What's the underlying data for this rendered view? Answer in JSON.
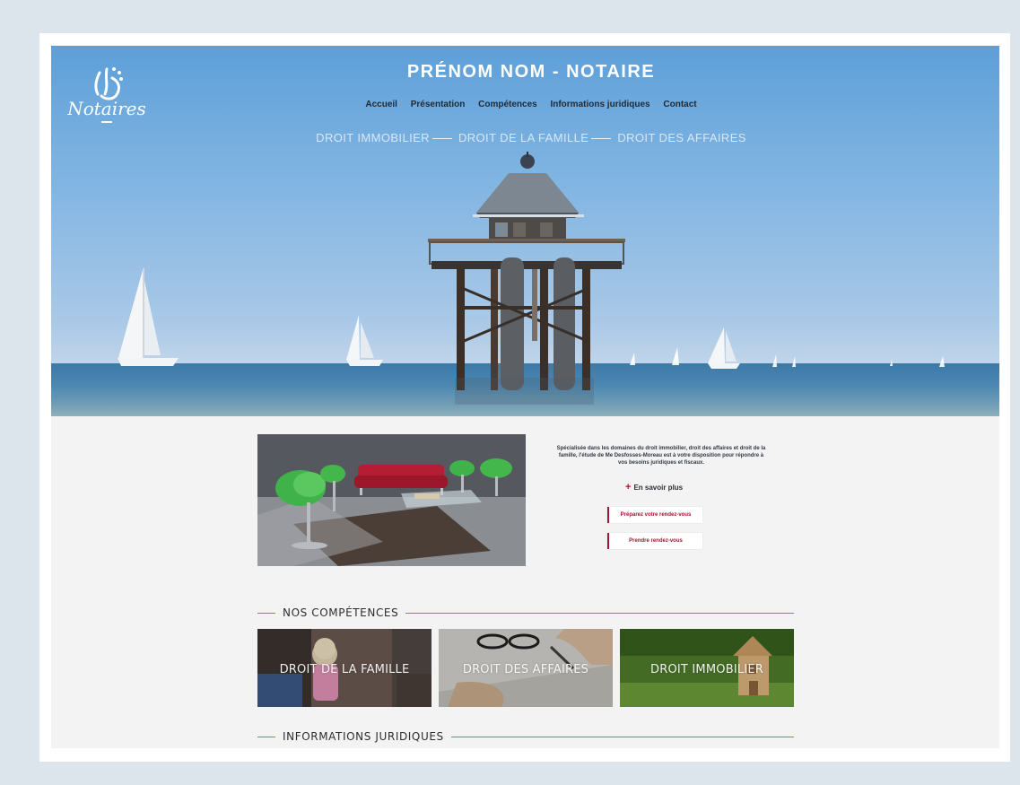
{
  "site": {
    "title": "PRÉNOM NOM - NOTAIRE",
    "logo_text": "Notaires"
  },
  "nav": {
    "items": [
      "Accueil",
      "Présentation",
      "Compétences",
      "Informations juridiques",
      "Contact"
    ]
  },
  "subnav": {
    "items": [
      "DROIT IMMOBILIER",
      "DROIT DE LA FAMILLE",
      "DROIT DES AFFAIRES"
    ]
  },
  "intro": {
    "text": "Spécialisée dans les domaines du droit immobilier, droit des affaires et droit de la famille, l'étude de Me Desfosses-Moreau est à votre disposition pour répondre à vos besoins juridiques et fiscaux.",
    "more_label": "En savoir plus",
    "prepare_button": "Préparez votre rendez-vous",
    "book_button": "Prendre rendez-vous"
  },
  "competences": {
    "heading": "NOS COMPÉTENCES",
    "tiles": [
      "DROIT DE LA FAMILLE",
      "DROIT DES AFFAIRES",
      "DROIT IMMOBILIER"
    ]
  },
  "informations": {
    "heading": "INFORMATIONS JURIDIQUES"
  },
  "colors": {
    "accent": "#9e1630",
    "section_line": "#6a9b4b",
    "sky": "#7fb4e2",
    "background": "#dde5ec"
  }
}
